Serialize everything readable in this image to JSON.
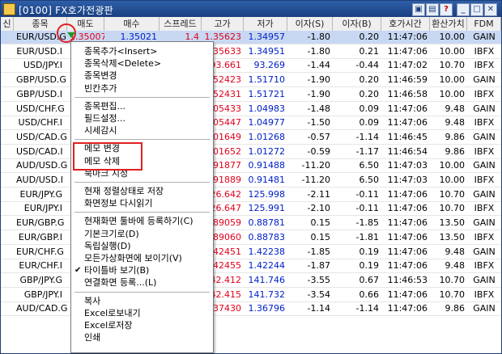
{
  "window": {
    "title": "[0100] FX호가전광판",
    "buttons": [
      "copy",
      "restore",
      "help",
      "minimize",
      "maximize",
      "close"
    ],
    "help_label": "?"
  },
  "columns": [
    "신",
    "종목",
    "매도",
    "매수",
    "스프레드",
    "고가",
    "저가",
    "이자(S)",
    "이자(B)",
    "호가시간",
    "환산가치",
    "FDM"
  ],
  "rows": [
    {
      "sym": "EUR/USD.G",
      "sell": "1.35007",
      "buy": "1.35021",
      "spread": "1.4",
      "high": "1.35623",
      "low": "1.34957",
      "is": "-1.80",
      "ib": "0.20",
      "time": "11:47:06",
      "val": "10.00",
      "fdm": "GAIN"
    },
    {
      "sym": "EUR/USD.I",
      "sell": "",
      "buy": "",
      "spread": "",
      "high": ".35633",
      "low": "1.34951",
      "is": "-1.80",
      "ib": "0.21",
      "time": "11:47:06",
      "val": "10.00",
      "fdm": "IBFX"
    },
    {
      "sym": "USD/JPY.I",
      "sell": "",
      "buy": "",
      "spread": "",
      "high": "93.661",
      "low": "93.269",
      "is": "-1.44",
      "ib": "-0.44",
      "time": "11:47:02",
      "val": "10.70",
      "fdm": "IBFX"
    },
    {
      "sym": "GBP/USD.G",
      "sell": "",
      "buy": "",
      "spread": "",
      "high": ".52423",
      "low": "1.51710",
      "is": "-1.90",
      "ib": "0.20",
      "time": "11:46:59",
      "val": "10.00",
      "fdm": "GAIN"
    },
    {
      "sym": "GBP/USD.I",
      "sell": "",
      "buy": "",
      "spread": "",
      "high": ".52431",
      "low": "1.51721",
      "is": "-1.90",
      "ib": "0.20",
      "time": "11:46:58",
      "val": "10.00",
      "fdm": "IBFX"
    },
    {
      "sym": "USD/CHF.G",
      "sell": "",
      "buy": "",
      "spread": "",
      "high": ".05433",
      "low": "1.04983",
      "is": "-1.48",
      "ib": "0.09",
      "time": "11:47:06",
      "val": "9.48",
      "fdm": "GAIN"
    },
    {
      "sym": "USD/CHF.I",
      "sell": "",
      "buy": "",
      "spread": "",
      "high": ".05447",
      "low": "1.04977",
      "is": "-1.50",
      "ib": "0.09",
      "time": "11:47:06",
      "val": "9.48",
      "fdm": "IBFX"
    },
    {
      "sym": "USD/CAD.G",
      "sell": "",
      "buy": "",
      "spread": "",
      "high": ".01649",
      "low": "1.01268",
      "is": "-0.57",
      "ib": "-1.14",
      "time": "11:46:45",
      "val": "9.86",
      "fdm": "GAIN"
    },
    {
      "sym": "USD/CAD.I",
      "sell": "",
      "buy": "",
      "spread": "",
      "high": ".01652",
      "low": "1.01272",
      "is": "-0.59",
      "ib": "-1.17",
      "time": "11:46:54",
      "val": "9.86",
      "fdm": "IBFX"
    },
    {
      "sym": "AUD/USD.G",
      "sell": "",
      "buy": "",
      "spread": "",
      "high": ".91877",
      "low": "0.91488",
      "is": "-11.20",
      "ib": "6.50",
      "time": "11:47:03",
      "val": "10.00",
      "fdm": "GAIN"
    },
    {
      "sym": "AUD/USD.I",
      "sell": "",
      "buy": "",
      "spread": "",
      "high": ".91889",
      "low": "0.91481",
      "is": "-11.20",
      "ib": "6.50",
      "time": "11:47:03",
      "val": "10.00",
      "fdm": "IBFX"
    },
    {
      "sym": "EUR/JPY.G",
      "sell": "",
      "buy": "",
      "spread": "",
      "high": "26.642",
      "low": "125.998",
      "is": "-2.11",
      "ib": "-0.11",
      "time": "11:47:06",
      "val": "10.70",
      "fdm": "GAIN"
    },
    {
      "sym": "EUR/JPY.I",
      "sell": "",
      "buy": "",
      "spread": "",
      "high": "26.647",
      "low": "125.991",
      "is": "-2.10",
      "ib": "-0.11",
      "time": "11:47:06",
      "val": "10.70",
      "fdm": "IBFX"
    },
    {
      "sym": "EUR/GBP.G",
      "sell": "",
      "buy": "",
      "spread": "",
      "high": ".89059",
      "low": "0.88781",
      "is": "0.15",
      "ib": "-1.85",
      "time": "11:47:06",
      "val": "13.50",
      "fdm": "GAIN"
    },
    {
      "sym": "EUR/GBP.I",
      "sell": "",
      "buy": "",
      "spread": "",
      "high": ".89060",
      "low": "0.88783",
      "is": "0.15",
      "ib": "-1.81",
      "time": "11:47:06",
      "val": "13.50",
      "fdm": "IBFX"
    },
    {
      "sym": "EUR/CHF.G",
      "sell": "",
      "buy": "",
      "spread": "",
      "high": ".42451",
      "low": "1.42238",
      "is": "-1.85",
      "ib": "0.19",
      "time": "11:47:06",
      "val": "9.48",
      "fdm": "GAIN"
    },
    {
      "sym": "EUR/CHF.I",
      "sell": "",
      "buy": "",
      "spread": "",
      "high": ".42455",
      "low": "1.42244",
      "is": "-1.87",
      "ib": "0.19",
      "time": "11:47:06",
      "val": "9.48",
      "fdm": "IBFX"
    },
    {
      "sym": "GBP/JPY.G",
      "sell": "",
      "buy": "",
      "spread": "",
      "high": "42.412",
      "low": "141.746",
      "is": "-3.55",
      "ib": "0.67",
      "time": "11:46:53",
      "val": "10.70",
      "fdm": "GAIN"
    },
    {
      "sym": "GBP/JPY.I",
      "sell": "",
      "buy": "",
      "spread": "",
      "high": "42.415",
      "low": "141.732",
      "is": "-3.54",
      "ib": "0.66",
      "time": "11:47:06",
      "val": "10.70",
      "fdm": "IBFX"
    },
    {
      "sym": "AUD/CAD.G",
      "sell": "",
      "buy": "",
      "spread": "",
      "high": ".37430",
      "low": "1.36796",
      "is": "-1.14",
      "ib": "-1.14",
      "time": "11:47:06",
      "val": "9.86",
      "fdm": "GAIN"
    }
  ],
  "context_menu": {
    "items": [
      {
        "label": "종목추가<Insert>"
      },
      {
        "label": "종목삭제<Delete>"
      },
      {
        "label": "종목변경"
      },
      {
        "label": "빈칸추가"
      },
      {
        "sep": true
      },
      {
        "label": "종목편집..."
      },
      {
        "label": "필드설정..."
      },
      {
        "label": "시세감시"
      },
      {
        "sep": true
      },
      {
        "label": "메모 변경"
      },
      {
        "label": "메모 삭제"
      },
      {
        "label": "북마크 지정"
      },
      {
        "sep": true
      },
      {
        "label": "현재 정렬상태로 저장"
      },
      {
        "label": "화면정보 다시읽기"
      },
      {
        "sep": true
      },
      {
        "label": "현재화면 툴바에 등록하기(C)"
      },
      {
        "label": "기본크기로(D)"
      },
      {
        "label": "독립실행(D)"
      },
      {
        "label": "모든가상화면에 보이기(V)"
      },
      {
        "label": "타이틀바 보기(B)",
        "checked": true
      },
      {
        "label": "연결화면 등록...(L)"
      },
      {
        "sep": true
      },
      {
        "label": "복사"
      },
      {
        "label": "Excel로보내기"
      },
      {
        "label": "Excel로저장"
      },
      {
        "label": "인쇄"
      }
    ]
  },
  "colors": {
    "sell_red": "#e0001b",
    "buy_blue": "#0020c8",
    "selected_row": "#c8d8f2",
    "title_bar": "#1a3f80",
    "annotation_red": "#e02020"
  }
}
